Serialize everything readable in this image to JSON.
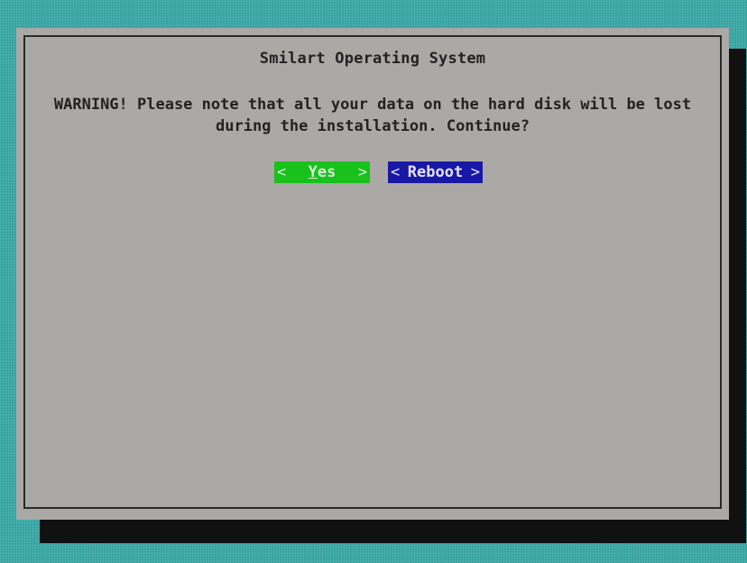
{
  "dialog": {
    "title": "Smilart Operating System",
    "message_line1": "WARNING! Please note that all your data on the hard disk will be lost",
    "message_line2": "during the installation. Continue?"
  },
  "buttons": {
    "yes": {
      "open": "<",
      "hotkey": "Y",
      "rest": "es",
      "close": ">"
    },
    "reboot": {
      "open": "<",
      "label": "Reboot",
      "close": ">"
    }
  },
  "colors": {
    "background": "#3aa8a6",
    "dialog": "#aaa9a5",
    "shadow": "#111111",
    "yes_button": "#17c21a",
    "reboot_button": "#1817a8"
  }
}
